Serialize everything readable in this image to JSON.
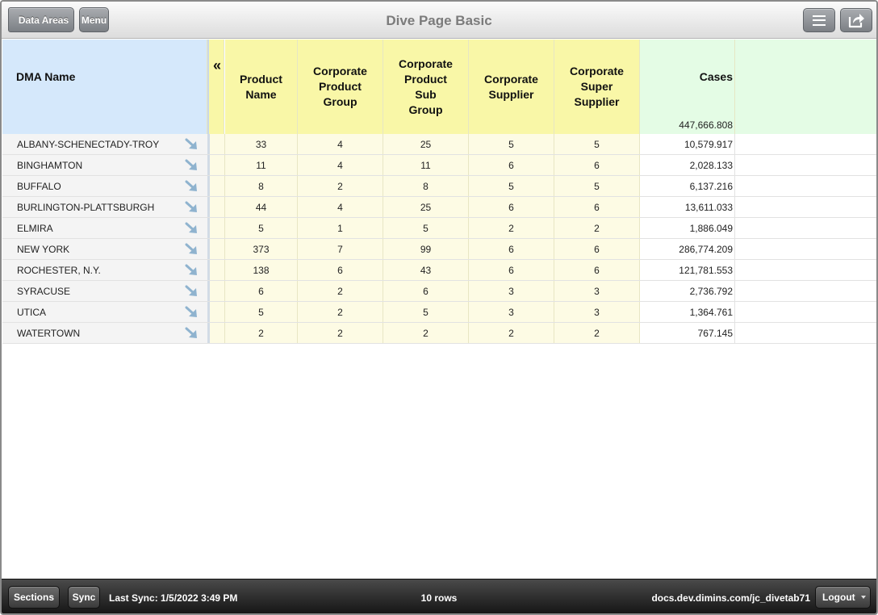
{
  "header": {
    "back_label": "Data Areas",
    "menu_label": "Menu",
    "title": "Dive Page Basic",
    "list_icon": "hamburger-icon",
    "share_icon": "share-icon"
  },
  "table": {
    "dma_header": "DMA Name",
    "collapse_glyph": "«",
    "columns": [
      {
        "label": "Product\nName"
      },
      {
        "label": "Corporate\nProduct\nGroup"
      },
      {
        "label": "Corporate\nProduct\nSub\nGroup"
      },
      {
        "label": "Corporate\nSupplier"
      },
      {
        "label": "Corporate\nSuper\nSupplier"
      }
    ],
    "cases_header": "Cases",
    "cases_total": "447,666.808",
    "rows": [
      {
        "dma": "ALBANY-SCHENECTADY-TROY",
        "vals": [
          "33",
          "4",
          "25",
          "5",
          "5"
        ],
        "cases": "10,579.917"
      },
      {
        "dma": "BINGHAMTON",
        "vals": [
          "11",
          "4",
          "11",
          "6",
          "6"
        ],
        "cases": "2,028.133"
      },
      {
        "dma": "BUFFALO",
        "vals": [
          "8",
          "2",
          "8",
          "5",
          "5"
        ],
        "cases": "6,137.216"
      },
      {
        "dma": "BURLINGTON-PLATTSBURGH",
        "vals": [
          "44",
          "4",
          "25",
          "6",
          "6"
        ],
        "cases": "13,611.033"
      },
      {
        "dma": "ELMIRA",
        "vals": [
          "5",
          "1",
          "5",
          "2",
          "2"
        ],
        "cases": "1,886.049"
      },
      {
        "dma": "NEW YORK",
        "vals": [
          "373",
          "7",
          "99",
          "6",
          "6"
        ],
        "cases": "286,774.209"
      },
      {
        "dma": "ROCHESTER, N.Y.",
        "vals": [
          "138",
          "6",
          "43",
          "6",
          "6"
        ],
        "cases": "121,781.553"
      },
      {
        "dma": "SYRACUSE",
        "vals": [
          "6",
          "2",
          "6",
          "3",
          "3"
        ],
        "cases": "2,736.792"
      },
      {
        "dma": "UTICA",
        "vals": [
          "5",
          "2",
          "5",
          "3",
          "3"
        ],
        "cases": "1,364.761"
      },
      {
        "dma": "WATERTOWN",
        "vals": [
          "2",
          "2",
          "2",
          "2",
          "2"
        ],
        "cases": "767.145"
      }
    ],
    "dive_icon": "dive-arrow-icon"
  },
  "footer": {
    "sections_label": "Sections",
    "sync_label": "Sync",
    "last_sync": "Last Sync: 1/5/2022 3:49 PM",
    "row_count": "10 rows",
    "host": "docs.dev.dimins.com/jc_divetab71",
    "logout_label": "Logout"
  },
  "colors": {
    "dma_header_bg": "#d5e8fb",
    "dim_header_bg": "#f9f7a7",
    "dim_cell_bg": "#fdfbe4",
    "measure_header_bg": "#e4fce5",
    "dive_icon": "#8fb3cf"
  }
}
